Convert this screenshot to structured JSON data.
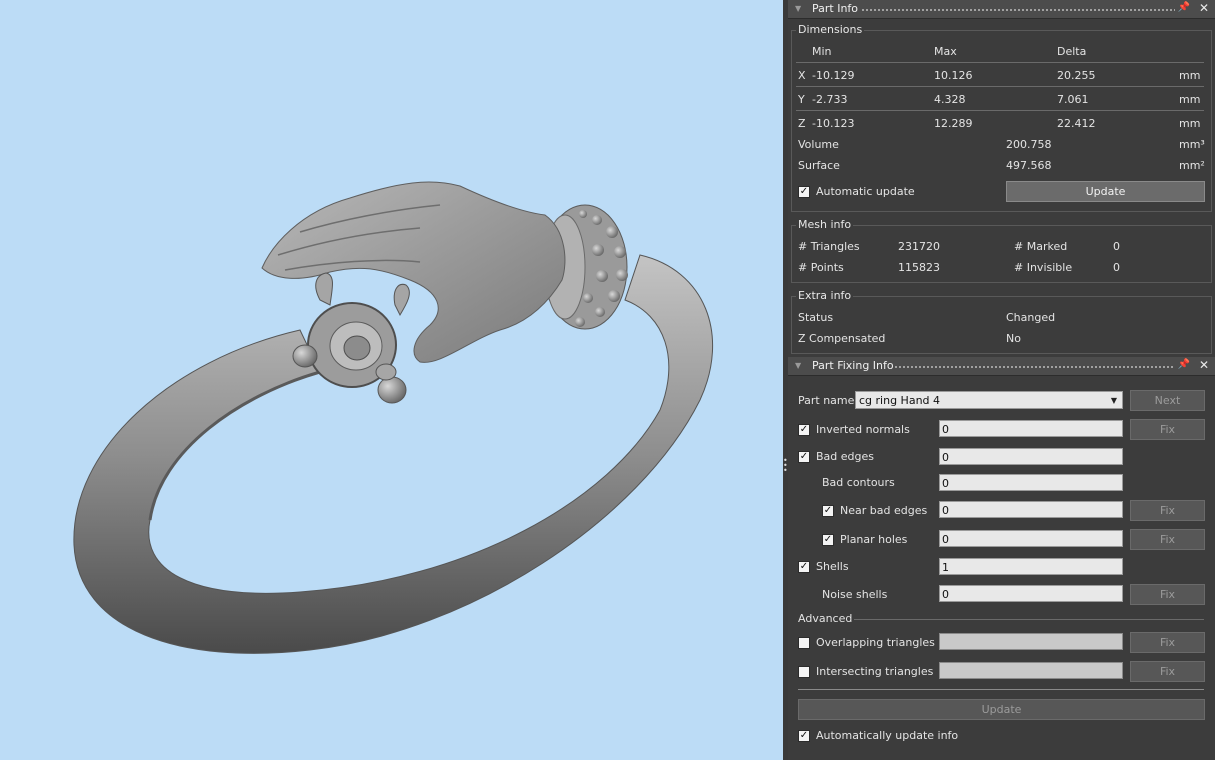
{
  "colors": {
    "viewport_bg": "#bcdcf6",
    "panel_bg": "#3c3c3c",
    "model_gray": "#8c8c8c"
  },
  "part_info": {
    "title": "Part Info",
    "dimensions": {
      "group_title": "Dimensions",
      "headers": {
        "min": "Min",
        "max": "Max",
        "delta": "Delta"
      },
      "rows": [
        {
          "axis": "X",
          "min": "-10.129",
          "max": "10.126",
          "delta": "20.255",
          "unit": "mm"
        },
        {
          "axis": "Y",
          "min": "-2.733",
          "max": "4.328",
          "delta": "7.061",
          "unit": "mm"
        },
        {
          "axis": "Z",
          "min": "-10.123",
          "max": "12.289",
          "delta": "22.412",
          "unit": "mm"
        }
      ],
      "volume_label": "Volume",
      "volume_value": "200.758",
      "volume_unit": "mm³",
      "surface_label": "Surface",
      "surface_value": "497.568",
      "surface_unit": "mm²",
      "auto_update_label": "Automatic update",
      "auto_update_checked": true,
      "update_button": "Update"
    },
    "mesh_info": {
      "group_title": "Mesh info",
      "triangles_label": "# Triangles",
      "triangles_value": "231720",
      "marked_label": "# Marked",
      "marked_value": "0",
      "points_label": "# Points",
      "points_value": "115823",
      "invisible_label": "# Invisible",
      "invisible_value": "0"
    },
    "extra_info": {
      "group_title": "Extra info",
      "status_label": "Status",
      "status_value": "Changed",
      "zcomp_label": "Z Compensated",
      "zcomp_value": "No"
    }
  },
  "part_fixing": {
    "title": "Part Fixing Info",
    "part_name_label": "Part name",
    "part_name_value": "cg ring Hand 4",
    "next_button": "Next",
    "inverted_normals": {
      "label": "Inverted normals",
      "value": "0",
      "checked": true,
      "fix": "Fix"
    },
    "bad_edges": {
      "label": "Bad edges",
      "value": "0",
      "checked": true
    },
    "bad_contours": {
      "label": "Bad contours",
      "value": "0"
    },
    "near_bad_edges": {
      "label": "Near bad edges",
      "value": "0",
      "checked": true,
      "fix": "Fix"
    },
    "planar_holes": {
      "label": "Planar holes",
      "value": "0",
      "checked": true,
      "fix": "Fix"
    },
    "shells": {
      "label": "Shells",
      "value": "1",
      "checked": true
    },
    "noise_shells": {
      "label": "Noise shells",
      "value": "0",
      "fix": "Fix"
    },
    "advanced_label": "Advanced",
    "overlapping": {
      "label": "Overlapping triangles",
      "value": "",
      "checked": false,
      "fix": "Fix"
    },
    "intersecting": {
      "label": "Intersecting triangles",
      "value": "",
      "checked": false,
      "fix": "Fix"
    },
    "update_button": "Update",
    "auto_update_label": "Automatically update info",
    "auto_update_checked": true
  }
}
